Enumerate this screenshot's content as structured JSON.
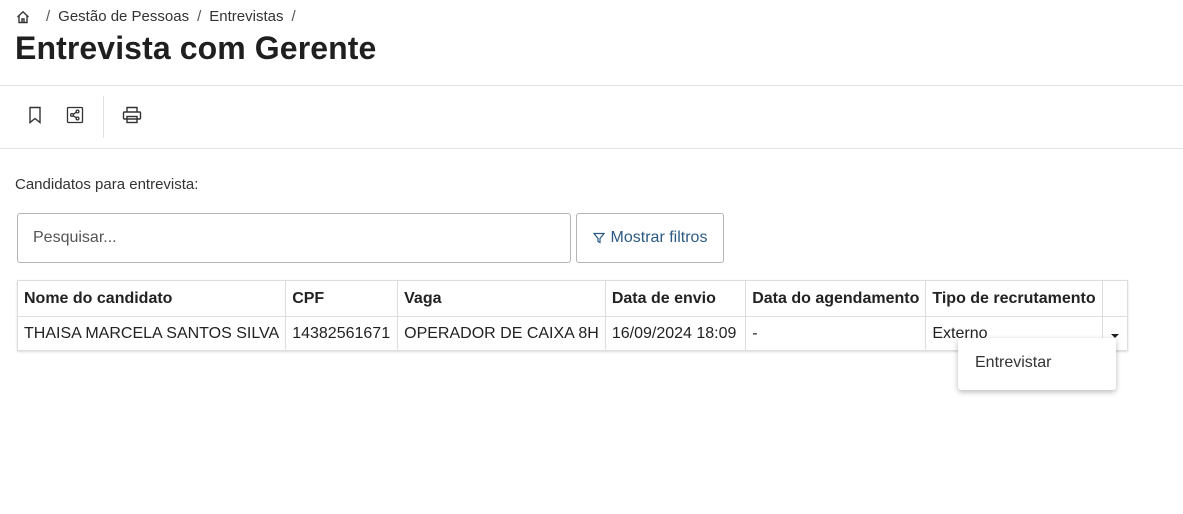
{
  "breadcrumb": {
    "icon": "home-icon",
    "items": [
      "Gestão de Pessoas",
      "Entrevistas"
    ],
    "separator": "/"
  },
  "page": {
    "title": "Entrevista com Gerente"
  },
  "toolbar": {
    "icons": [
      "bookmark-icon",
      "share-icon",
      "print-icon"
    ]
  },
  "section": {
    "label": "Candidatos para entrevista:"
  },
  "search": {
    "placeholder": "Pesquisar..."
  },
  "filter": {
    "label": "Mostrar filtros",
    "icon": "filter-icon",
    "color": "#2c5a85"
  },
  "table": {
    "columns": [
      "Nome do candidato",
      "CPF",
      "Vaga",
      "Data de envio",
      "Data do agendamento",
      "Tipo de recrutamento"
    ],
    "rows": [
      [
        "THAISA MARCELA SANTOS SILVA",
        "14382561671",
        "OPERADOR DE CAIXA 8H",
        "16/09/2024 18:09",
        "-",
        "Externo"
      ]
    ]
  },
  "dropdown": {
    "items": [
      "Entrevistar"
    ]
  }
}
